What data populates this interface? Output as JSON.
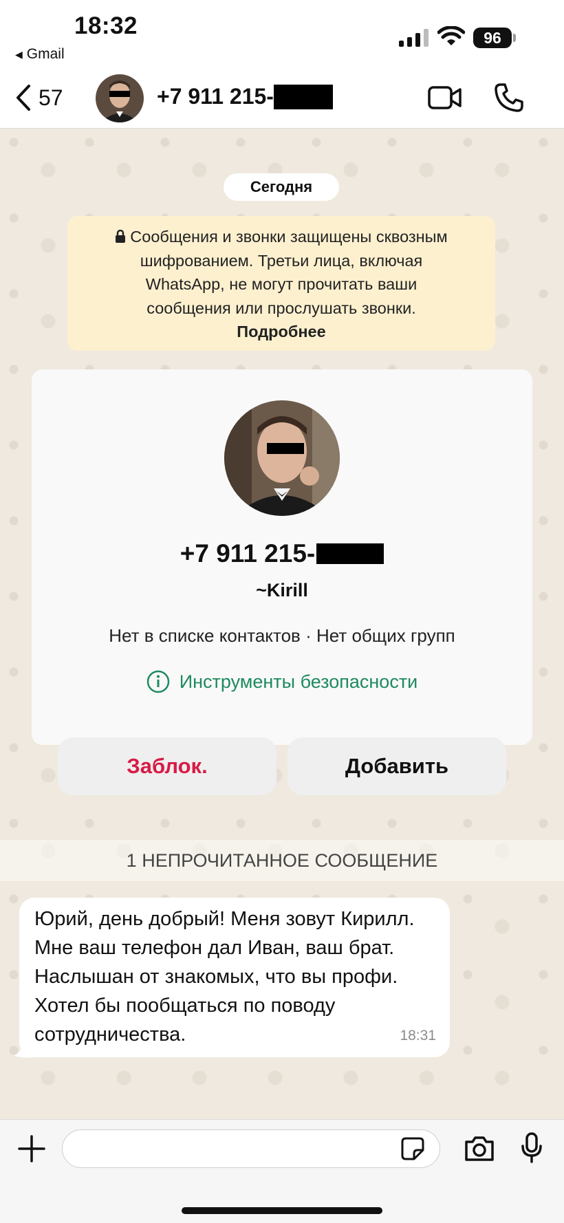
{
  "status_bar": {
    "time": "18:32",
    "back_app": "Gmail",
    "battery": "96"
  },
  "header": {
    "back_count": "57",
    "title_prefix": "+7 911 215-"
  },
  "chat": {
    "date_label": "Сегодня",
    "encryption": {
      "lines": [
        "Сообщения и звонки защищены сквозным",
        "шифрованием. Третьи лица, включая",
        "WhatsApp, не могут прочитать ваши",
        "сообщения или прослушать звонки."
      ],
      "link": "Подробнее"
    },
    "contact_card": {
      "phone_prefix": "+7 911 215-",
      "name": "~Kirill",
      "info": "Нет в списке контактов · Нет общих групп",
      "safety_tools": "Инструменты безопасности",
      "block_label": "Заблок.",
      "add_label": "Добавить"
    },
    "unread_label": "1 НЕПРОЧИТАННОЕ СООБЩЕНИЕ",
    "message": {
      "text": "Юрий, день добрый! Меня зовут Кирилл. Мне ваш телефон дал Иван, ваш брат. Наслышан от знакомых, что вы профи. Хотел бы пообщаться по поводу сотрудничества.",
      "time": "18:31"
    }
  },
  "input_bar": {
    "placeholder": ""
  },
  "colors": {
    "accent_green": "#1d8a5e",
    "block_red": "#d81b47",
    "encryption_bg": "#fdf0cf"
  },
  "icons": [
    "back-chevron-icon",
    "video-call-icon",
    "phone-icon",
    "lock-icon",
    "info-icon",
    "plus-icon",
    "sticker-icon",
    "camera-icon",
    "mic-icon"
  ]
}
